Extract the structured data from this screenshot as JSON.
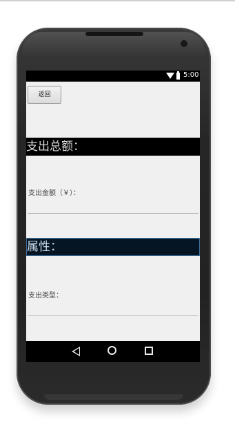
{
  "status_bar": {
    "time": "5:00",
    "icons": [
      "wifi-icon",
      "battery-icon"
    ]
  },
  "toolbar": {
    "back_label": "返回"
  },
  "sections": {
    "total": {
      "title": "支出总额："
    },
    "attributes": {
      "title": "属性："
    }
  },
  "fields": {
    "amount": {
      "label": "支出金额（￥）：",
      "value": ""
    },
    "type": {
      "label": "支出类型：",
      "value": ""
    }
  },
  "nav_bar": {
    "icons": [
      "back-triangle-icon",
      "home-circle-icon",
      "recents-square-icon"
    ]
  },
  "colors": {
    "screen_background": "#f0f0f0",
    "section_header_bg": "#000000",
    "selected_header_bg": "#061523",
    "selected_header_border": "#3b6e9b"
  }
}
